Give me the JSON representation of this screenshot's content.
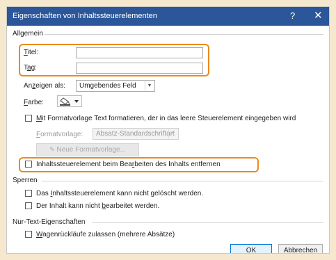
{
  "dialog": {
    "title": "Eigenschaften von Inhaltssteuerelementen",
    "help_glyph": "?",
    "close_glyph": "✕"
  },
  "general": {
    "group_label": "Allgemein",
    "title_label": "Titel:",
    "title_value": "",
    "tag_label": "Tag:",
    "tag_value": "",
    "show_as_label": "Anzeigen als:",
    "show_as_value": "Umgebendes Feld",
    "color_label": "Farbe:",
    "format_checkbox_label": "Mit Formatvorlage Text formatieren, der in das leere Steuerelement eingegeben wird",
    "style_label": "Formatvorlage:",
    "style_value": "Absatz-Standardschriftart",
    "new_style_button": "Neue Formatvorlage...",
    "remove_checkbox_label": "Inhaltssteuerelement beim Bearbeiten des Inhalts entfernen"
  },
  "locking": {
    "group_label": "Sperren",
    "cannot_delete_label": "Das Inhaltssteuerelement kann nicht gelöscht werden.",
    "cannot_edit_label": "Der Inhalt kann nicht bearbeitet werden."
  },
  "plain_text": {
    "group_label": "Nur-Text-Eigenschaften",
    "multi_paragraph_label": "Wagenrückläufe zulassen (mehrere Absätze)"
  },
  "buttons": {
    "ok": "OK",
    "cancel": "Abbrechen"
  },
  "colors": {
    "titlebar": "#2b579a",
    "highlight": "#e98a1e",
    "background": "#f6e8cf"
  },
  "icons": {
    "color_picker": "paint-bucket-icon",
    "dropdown": "chevron-down-icon",
    "close": "close-icon",
    "help": "help-icon"
  }
}
